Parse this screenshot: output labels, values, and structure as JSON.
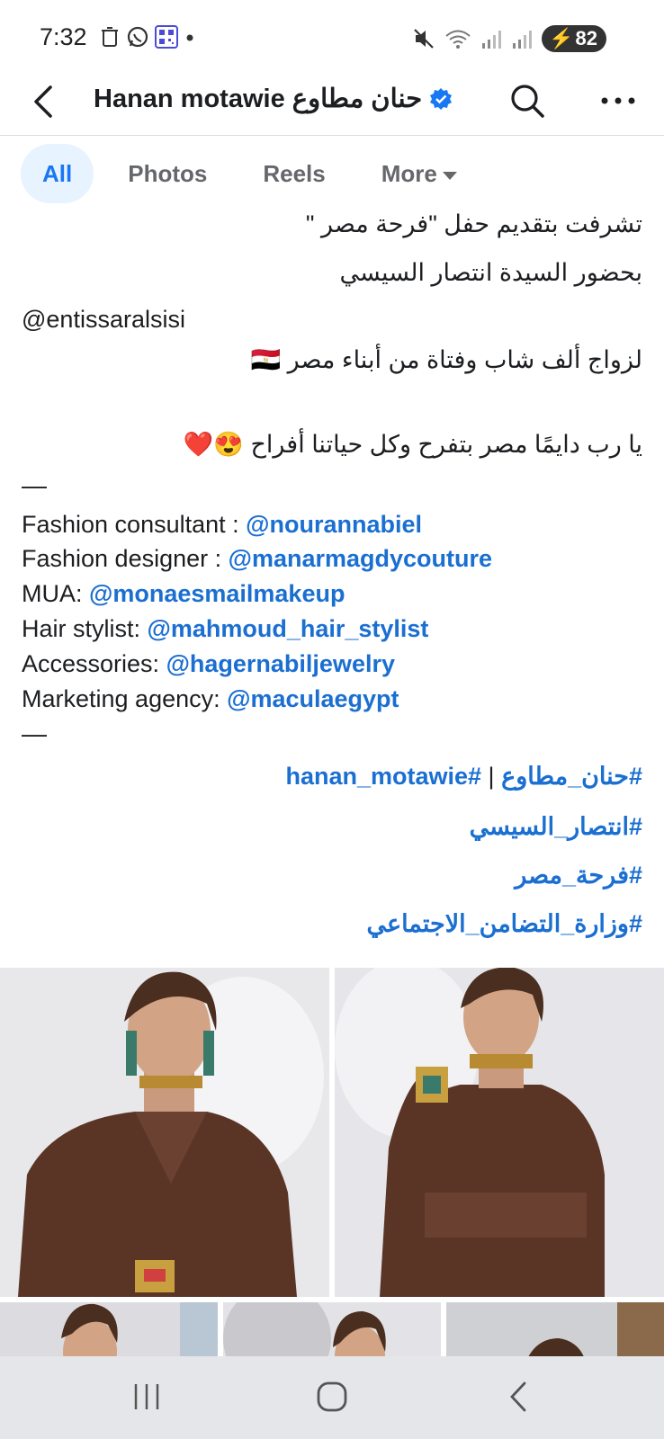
{
  "status": {
    "time": "7:32",
    "battery": "82"
  },
  "header": {
    "title": "Hanan motawie حنان مطاوع"
  },
  "tabs": [
    {
      "label": "All"
    },
    {
      "label": "Photos"
    },
    {
      "label": "Reels"
    },
    {
      "label": "More"
    }
  ],
  "post": {
    "lines_ar": [
      "تشرفت بتقديم حفل \"فرحة مصر \"",
      "بحضور السيدة انتصار السيسي"
    ],
    "mention_top": "@entissaralsisi",
    "line_ar_3": "لزواج ألف شاب وفتاة من أبناء مصر 🇪🇬",
    "line_ar_4": "يا رب دايمًا مصر بتفرح وكل حياتنا أفراح 😍❤️",
    "dash": "—",
    "credits": [
      {
        "label": "Fashion consultant : ",
        "handle": "@nourannabiel"
      },
      {
        "label": "Fashion designer : ",
        "handle": "@manarmagdycouture"
      },
      {
        "label": "MUA: ",
        "handle": "@monaesmailmakeup"
      },
      {
        "label": "Hair stylist: ",
        "handle": "@mahmoud_hair_stylist"
      },
      {
        "label": "Accessories: ",
        "handle": "@hagernabiljewelry"
      },
      {
        "label": "Marketing agency: ",
        "handle": "@maculaegypt"
      }
    ],
    "hashtags_line1": {
      "a": "#حنان_مطاوع",
      "sep": " | ",
      "b": "#hanan_motawie"
    },
    "hashtags": [
      "#انتصار_السيسي",
      "#فرحة_مصر",
      "#وزارة_التضامن_الاجتماعي"
    ]
  },
  "icons": {
    "back": "back-arrow-icon",
    "search": "search-icon",
    "more": "more-dots-icon",
    "verified": "verified-badge-icon"
  },
  "colors": {
    "link": "#1a6fd1",
    "tab_active_bg": "#e7f3ff",
    "tab_active": "#1877f2",
    "dress": "#5a3526"
  }
}
